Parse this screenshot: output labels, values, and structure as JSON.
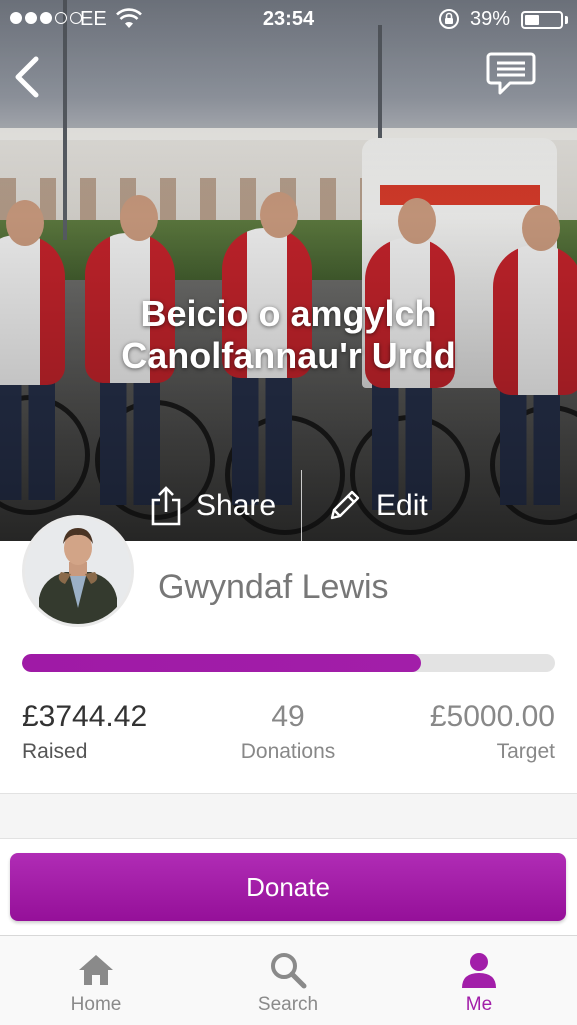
{
  "status_bar": {
    "carrier": "EE",
    "time": "23:54",
    "battery_percent": "39%",
    "battery_level": 0.39
  },
  "page": {
    "title_line1": "Beicio o amgylch",
    "title_line2": "Canolfannau'r Urdd"
  },
  "actions": {
    "share_label": "Share",
    "edit_label": "Edit"
  },
  "owner": {
    "name": "Gwyndaf Lewis"
  },
  "progress": {
    "fraction": 0.749
  },
  "stats": {
    "raised_value": "£3744.42",
    "raised_label": "Raised",
    "donations_value": "49",
    "donations_label": "Donations",
    "target_value": "£5000.00",
    "target_label": "Target"
  },
  "donate": {
    "label": "Donate"
  },
  "tabs": [
    {
      "label": "Home",
      "icon": "home-icon",
      "active": false
    },
    {
      "label": "Search",
      "icon": "search-icon",
      "active": false
    },
    {
      "label": "Me",
      "icon": "person-icon",
      "active": true
    }
  ],
  "colors": {
    "accent": "#a21ea9",
    "inactive_tab": "#8a8a8a"
  }
}
